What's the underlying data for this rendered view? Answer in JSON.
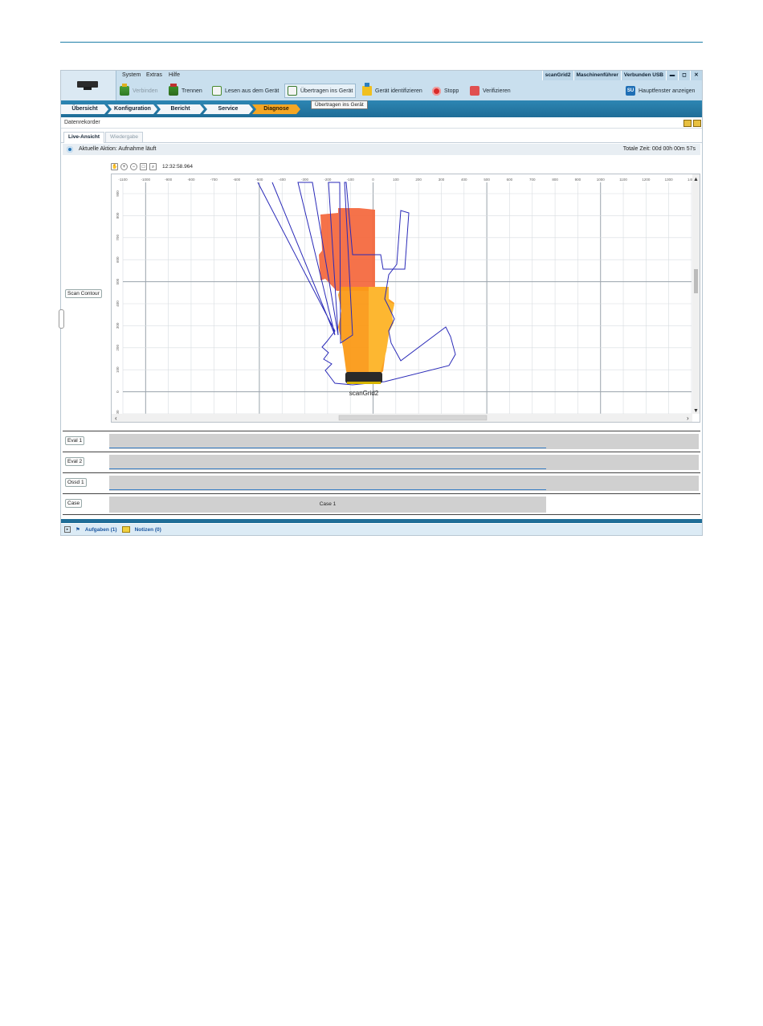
{
  "menu": {
    "system": "System",
    "extras": "Extras",
    "help": "Hilfe"
  },
  "status": {
    "device": "scanGrid2",
    "user": "Maschinenführer",
    "connection": "Verbunden USB"
  },
  "window_buttons": {
    "minimize": "▬",
    "maximize": "◻",
    "close": "✕"
  },
  "toolbar": {
    "connect": "Verbinden",
    "disconnect": "Trennen",
    "read": "Lesen aus dem Gerät",
    "transfer": "Übertragen ins Gerät",
    "identify": "Gerät identifizieren",
    "stop": "Stopp",
    "verify": "Verifizieren",
    "main_window_icon": "SU",
    "main_window": "Hauptfenster anzeigen"
  },
  "tooltip": "Übertragen ins Gerät",
  "breadcrumbs": [
    "Übersicht",
    "Konfiguration",
    "Bericht",
    "Service",
    "Diagnose"
  ],
  "section_title": "Datenrekorder",
  "tabs": {
    "live": "Live-Ansicht",
    "playback": "Wiedergabe"
  },
  "action": {
    "current": "Aktuelle Aktion: Aufnahme läuft",
    "total": "Totale Zeit: 00d 00h 00m 57s"
  },
  "plot": {
    "timestamp": "12:32:58.964",
    "scan_button": "Scan Contour",
    "device_label": "scanGrid2",
    "x_ticks": [
      "-1100",
      "-1000",
      "-900",
      "-800",
      "-700",
      "-600",
      "-500",
      "-400",
      "-300",
      "-200",
      "-100",
      "0",
      "100",
      "200",
      "300",
      "400",
      "500",
      "600",
      "700",
      "800",
      "900",
      "1000",
      "1100",
      "1200",
      "1300",
      "1400"
    ],
    "y_ticks": [
      "900",
      "800",
      "700",
      "600",
      "500",
      "400",
      "300",
      "200",
      "100",
      "0",
      "-100"
    ],
    "colors": {
      "warning_field": "#fdb833",
      "protective_field": "#fb9a17",
      "far_field": "#f4663b",
      "contour": "#2a2ab8",
      "device": "#2a2a2a"
    }
  },
  "lanes": [
    {
      "label": "Eval 1"
    },
    {
      "label": "Eval 2"
    },
    {
      "label": "Ossd 1"
    },
    {
      "label": "Case",
      "value": "Case 1"
    }
  ],
  "footer": {
    "tasks": "Aufgaben (1)",
    "notes": "Notizen (0)",
    "expand": "▸"
  }
}
